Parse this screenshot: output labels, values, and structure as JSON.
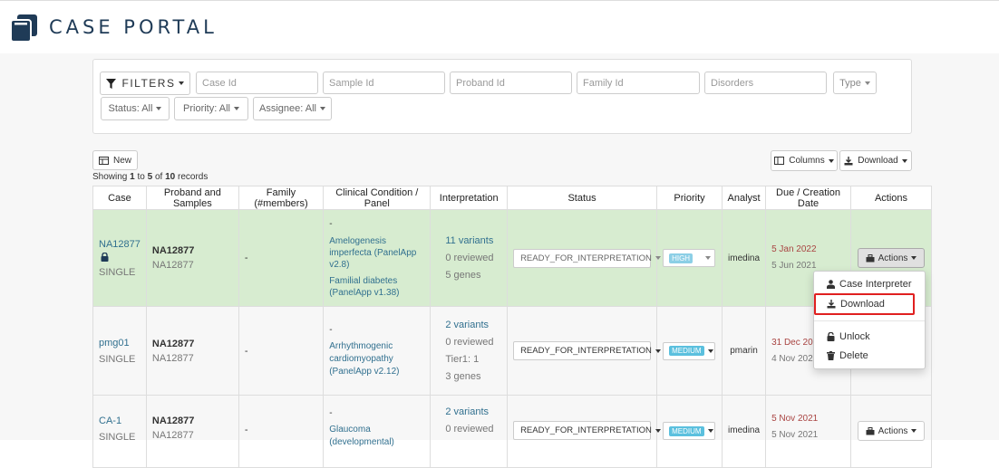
{
  "app": {
    "title": "CASE PORTAL"
  },
  "filters": {
    "button_label": "FILTERS",
    "case_id_placeholder": "Case Id",
    "sample_id_placeholder": "Sample Id",
    "proband_id_placeholder": "Proband Id",
    "family_id_placeholder": "Family Id",
    "disorders_placeholder": "Disorders",
    "type_label": "Type",
    "status_label": "Status: All",
    "priority_label": "Priority: All",
    "assignee_label": "Assignee: All"
  },
  "toolbar": {
    "new_label": "New",
    "columns_label": "Columns",
    "download_label": "Download",
    "records_prefix": "Showing",
    "records_from": "1",
    "records_to_word": "to",
    "records_to": "5",
    "records_of_word": "of",
    "records_total": "10",
    "records_suffix": "records"
  },
  "table": {
    "columns": [
      "Case",
      "Proband and Samples",
      "Family (#members)",
      "Clinical Condition / Panel",
      "Interpretation",
      "Status",
      "Priority",
      "Analyst",
      "Due / Creation Date",
      "Actions"
    ],
    "rows": [
      {
        "case_id": "NA12877",
        "case_type": "SINGLE",
        "proband": "NA12877",
        "sample": "NA12877",
        "family": "-",
        "panel_dash": "-",
        "condition1": "Amelogenesis imperfecta (PanelApp v2.8)",
        "condition2": "Familial diabetes (PanelApp v1.38)",
        "variants": "11 variants",
        "reviewed": "0 reviewed",
        "genes": "5 genes",
        "status": "READY_FOR_INTERPRETATION",
        "priority": "HIGH",
        "analyst": "imedina",
        "due": "5 Jan 2022",
        "created": "5 Jun 2021",
        "actions_label": "Actions"
      },
      {
        "case_id": "pmg01",
        "case_type": "SINGLE",
        "proband": "NA12877",
        "sample": "NA12877",
        "family": "-",
        "panel_dash": "-",
        "condition1": "Arrhythmogenic cardiomyopathy (PanelApp v2.12)",
        "variants": "2 variants",
        "reviewed": "0 reviewed",
        "tier": "Tier1: 1",
        "genes": "3 genes",
        "status": "READY_FOR_INTERPRETATION",
        "priority": "MEDIUM",
        "analyst": "pmarin",
        "due": "31 Dec 2021",
        "created": "4 Nov 2021"
      },
      {
        "case_id": "CA-1",
        "case_type": "SINGLE",
        "proband": "NA12877",
        "sample": "NA12877",
        "family": "-",
        "panel_dash": "-",
        "condition1": "Glaucoma (developmental)",
        "variants": "2 variants",
        "reviewed": "0 reviewed",
        "status": "READY_FOR_INTERPRETATION",
        "priority": "MEDIUM",
        "analyst": "imedina",
        "due": "5 Nov 2021",
        "created": "5 Nov 2021",
        "actions_label": "Actions"
      }
    ]
  },
  "actions_menu": {
    "case_interpreter": "Case Interpreter",
    "download": "Download",
    "unlock": "Unlock",
    "delete": "Delete"
  },
  "colors": {
    "brand": "#1f3b57",
    "link": "#31708f",
    "highlight_row": "#d7ecd0",
    "due_red": "#a94442",
    "priority_badge": "#5bc0de",
    "focus": "#e02020"
  }
}
